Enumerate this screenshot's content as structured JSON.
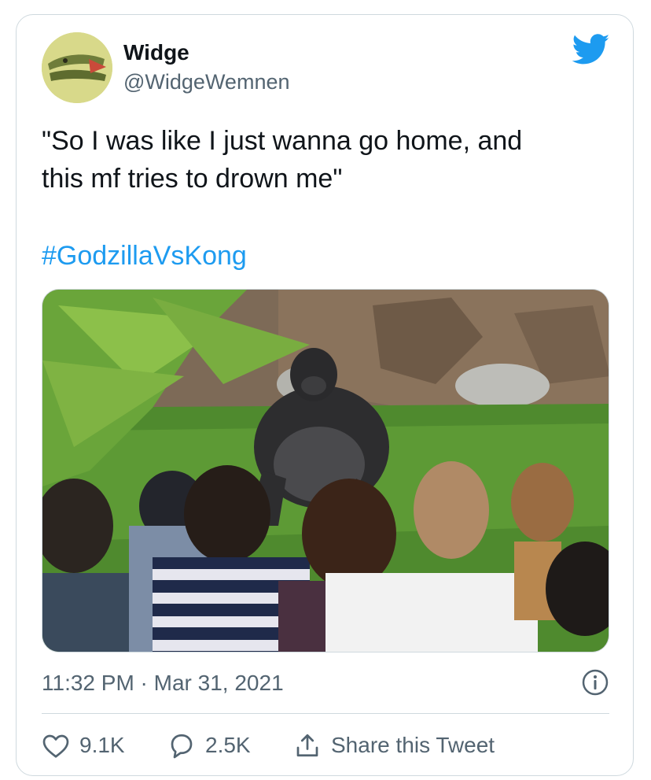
{
  "author": {
    "name": "Widge",
    "handle": "@WidgeWemnen"
  },
  "tweet": {
    "text": "\"So I was like I just wanna go home, and\nthis mf tries to drown me\"",
    "hashtag": "#GodzillaVsKong"
  },
  "meta": {
    "timestamp": "11:32 PM · Mar 31, 2021"
  },
  "actions": {
    "likes": "9.1K",
    "replies": "2.5K",
    "share_label": "Share this Tweet"
  },
  "colors": {
    "brand": "#1d9bf0",
    "text": "#0f1419",
    "muted": "#536471",
    "border": "#cfd9de"
  },
  "icons": [
    "twitter-bird-icon",
    "info-icon",
    "heart-icon",
    "reply-bubble-icon",
    "share-icon"
  ]
}
